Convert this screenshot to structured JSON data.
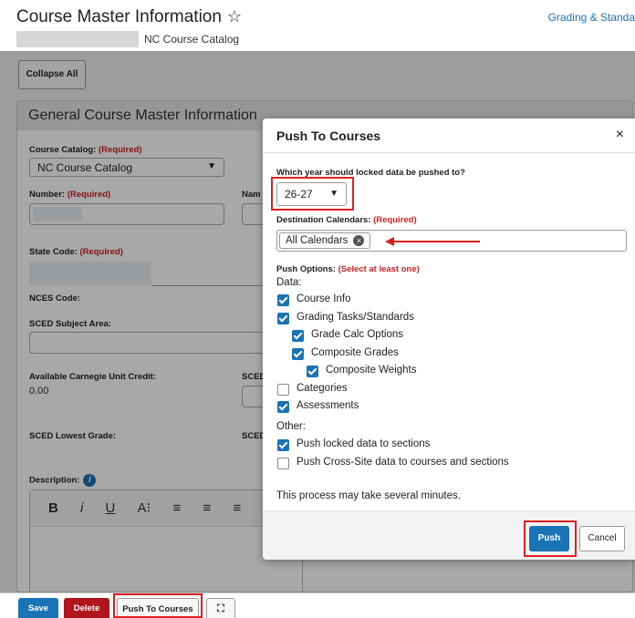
{
  "header": {
    "title": "Course Master Information",
    "star_glyph": "☆",
    "grading_link": "Grading & Standa",
    "catalog_name": "NC Course Catalog"
  },
  "main": {
    "collapse_all": "Collapse All",
    "section_title": "General Course Master Information",
    "fields": {
      "course_catalog_label": "Course Catalog:",
      "course_catalog_value": "NC Course Catalog",
      "required_marker": "(Required)",
      "number_label": "Number:",
      "name_label_partial": "Nam",
      "state_code_label": "State Code:",
      "nces_code_label": "NCES Code:",
      "sced_subject_label": "SCED Subject Area:",
      "carnegie_label": "Available Carnegie Unit Credit:",
      "carnegie_value": "0.00",
      "sced_partial_1": "SCED",
      "sced_lowest_label": "SCED Lowest Grade:",
      "sced_partial_2": "SCED",
      "description_label": "Description:",
      "info_glyph": "i"
    },
    "editor_toolbar": [
      "B",
      "i",
      "U",
      "A⁝",
      "≡",
      "≡",
      "≡"
    ]
  },
  "modal": {
    "title": "Push To Courses",
    "close_glyph": "×",
    "year_question": "Which year should locked data be pushed to?",
    "year_value": "26-27",
    "dest_label": "Destination Calendars:",
    "dest_required": "(Required)",
    "dest_chip": "All Calendars",
    "chip_remove_glyph": "×",
    "push_options_label": "Push Options:",
    "push_options_required": "(Select at least one)",
    "data_heading": "Data:",
    "options": {
      "course_info": "Course Info",
      "grading_tasks": "Grading Tasks/Standards",
      "grade_calc": "Grade Calc Options",
      "composite_grades": "Composite Grades",
      "composite_weights": "Composite Weights",
      "categories": "Categories",
      "assessments": "Assessments",
      "push_locked": "Push locked data to sections",
      "cross_site": "Push Cross-Site data to courses and sections"
    },
    "other_heading": "Other:",
    "process_note": "This process may take several minutes.",
    "push_button": "Push",
    "cancel_button": "Cancel"
  },
  "bottom_bar": {
    "save": "Save",
    "delete": "Delete",
    "push_to_courses": "Push To Courses",
    "expand_glyph": "⛶"
  },
  "colors": {
    "accent_blue": "#1a73b5",
    "danger_red": "#b0161e",
    "highlight_red": "#e02020"
  }
}
